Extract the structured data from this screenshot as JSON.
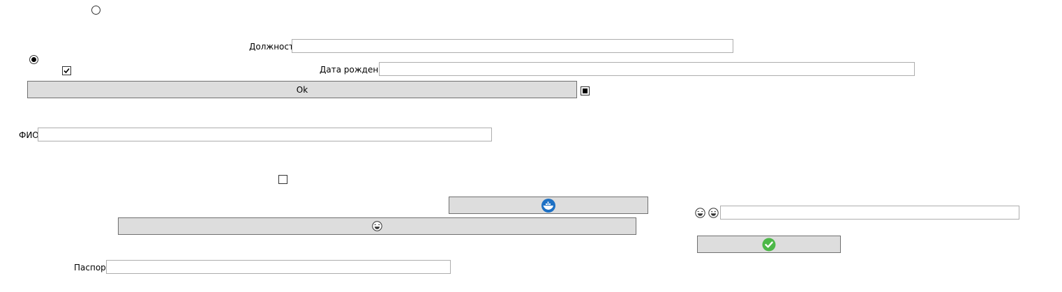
{
  "fields": {
    "position": {
      "label": "Должность",
      "value": ""
    },
    "birth_date": {
      "label": "Дата рождения",
      "value": ""
    },
    "full_name": {
      "label": "ФИО",
      "value": ""
    },
    "passport": {
      "label": "Паспорт",
      "value": ""
    },
    "emoji_field": {
      "value": ""
    }
  },
  "buttons": {
    "ok": {
      "label": "Ok"
    },
    "docker": {
      "icon": "docker-whale-icon",
      "color": "#1d70c4"
    },
    "emoji": {
      "icon": "laughing-face-icon"
    },
    "confirm": {
      "icon": "green-check-icon",
      "color": "#4cb848"
    }
  },
  "controls": {
    "radio_top": {
      "checked": false
    },
    "radio_left": {
      "checked": true
    },
    "checkbox_checked": {
      "checked": true
    },
    "checkbox_indeterminate": {
      "state": "indeterminate"
    },
    "checkbox_empty": {
      "checked": false
    }
  },
  "emoji_icons": [
    "laughing-face-icon",
    "grinning-face-icon"
  ]
}
